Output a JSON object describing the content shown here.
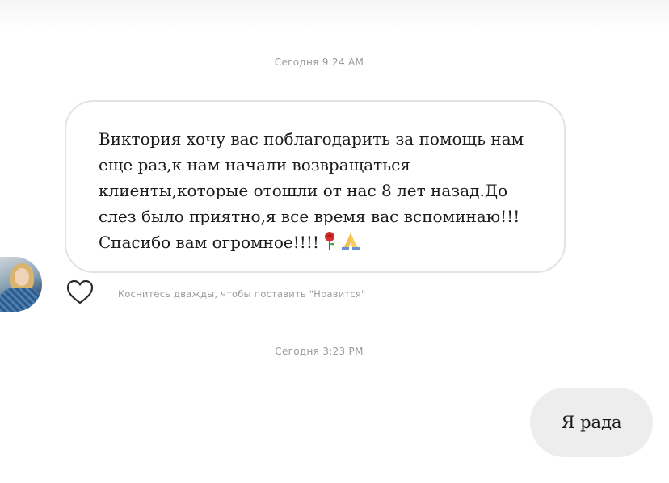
{
  "chat": {
    "timestamp_1": "Сегодня 9:24 AM",
    "incoming_message": {
      "text": "Виктория хочу вас поблагодарить за помощь нам еще раз,к нам начали возвращаться клиенты,которые отошли от нас 8 лет назад.До слез было приятно,я все время вас вспоминаю!!!Спасибо вам огромное!!!!",
      "emoji": [
        "rose-icon",
        "pray-icon"
      ]
    },
    "like_hint": "Коснитесь дважды, чтобы поставить \"Нравится\"",
    "timestamp_2": "Сегодня 3:23 PM",
    "outgoing_message": {
      "text": "Я рада"
    }
  },
  "colors": {
    "incoming_border": "#e3e3e3",
    "outgoing_bg": "#ededed",
    "meta_text": "#9a9a9a",
    "message_text": "#1b1b1b"
  }
}
